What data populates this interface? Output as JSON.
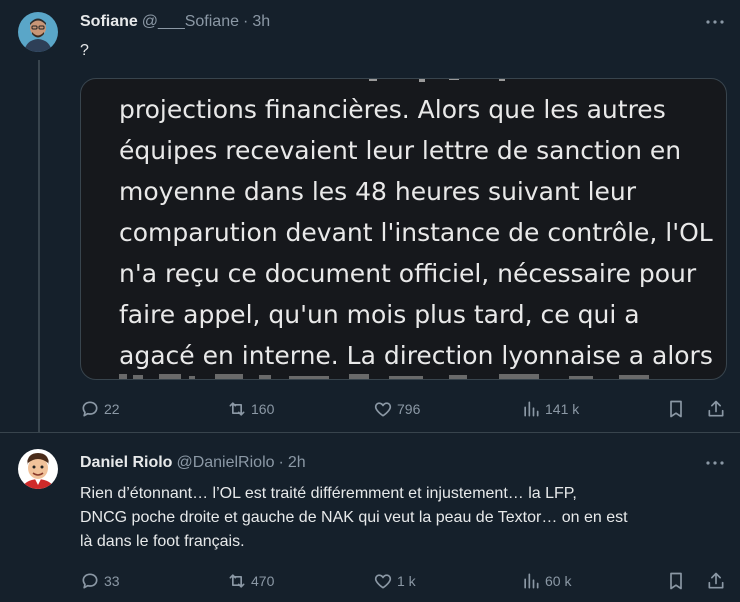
{
  "tweets": [
    {
      "name": "Sofiane",
      "handle": "@___Sofiane",
      "sep": "·",
      "time": "3h",
      "text": "?",
      "media_lines": [
        "projections financières. Alors que les autres",
        "équipes recevaient leur lettre de sanction en",
        "moyenne dans les 48 heures suivant leur",
        "comparution devant l'instance de contrôle, l'OL",
        "n'a reçu ce document officiel, nécessaire pour",
        "faire appel, qu'un mois plus tard, ce qui a",
        "agacé en interne. La direction lyonnaise a alors"
      ],
      "stats": {
        "replies": "22",
        "reposts": "160",
        "likes": "796",
        "views": "141 k"
      }
    },
    {
      "name": "Daniel Riolo",
      "handle": "@DanielRiolo",
      "sep": "·",
      "time": "2h",
      "text_lines": [
        "Rien d’étonnant… l’OL est traité différemment et injustement… la LFP,",
        "DNCG poche droite et gauche de NAK qui veut la peau de Textor… on en est",
        "là dans le foot français."
      ],
      "stats": {
        "replies": "33",
        "reposts": "470",
        "likes": "1 k",
        "views": "60 k"
      }
    }
  ],
  "colors": {
    "background": "#15202b",
    "text": "#e7e9ea",
    "muted": "#8b98a5",
    "border": "#38444d",
    "media_bg": "#16181c"
  },
  "icons": [
    "avatar",
    "more-icon",
    "reply-icon",
    "repost-icon",
    "like-icon",
    "views-icon",
    "bookmark-icon",
    "share-icon"
  ]
}
